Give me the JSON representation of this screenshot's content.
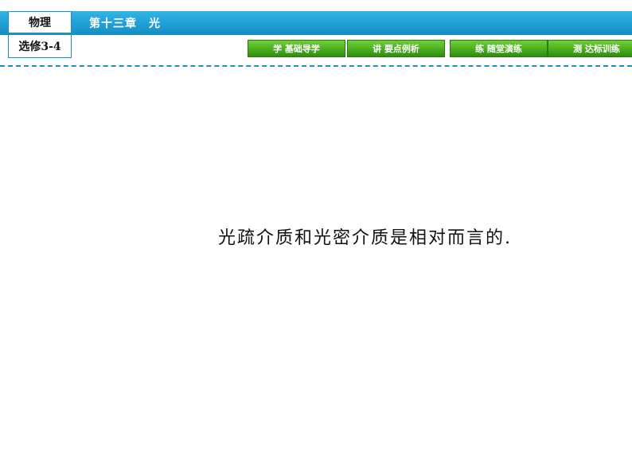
{
  "header": {
    "subject": "物理",
    "module": "选修3-4",
    "chapter": "第十三章　光"
  },
  "nav": {
    "items": [
      {
        "label": "学  基础导学"
      },
      {
        "label": "讲  要点例析"
      },
      {
        "label": "练  随堂演练"
      },
      {
        "label": "测  达标训练"
      }
    ]
  },
  "content": {
    "text": "光疏介质和光密介质是相对而言的."
  },
  "colors": {
    "header_blue": "#1f9fd6",
    "nav_green": "#4db020",
    "divider": "#1a8fc8"
  }
}
